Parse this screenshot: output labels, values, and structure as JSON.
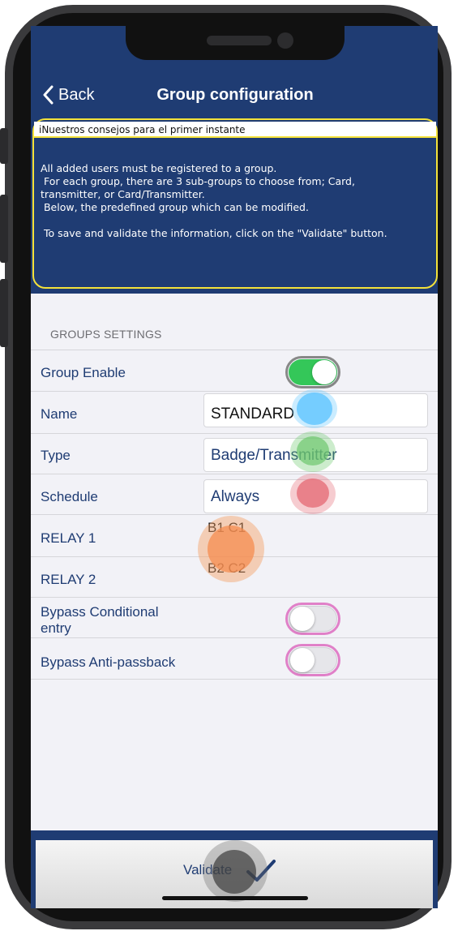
{
  "nav": {
    "back_label": "Back",
    "title": "Group configuration"
  },
  "tips": {
    "title": "iNuestros consejos para el primer instante",
    "body": "All added users must be registered to a group.\n For each group, there are 3 sub-groups to choose from; Card,\ntransmitter, or Card/Transmitter.\n Below, the predefined group which can be modified.\n\n To save and validate the information, click on the \"Validate\" button."
  },
  "settings": {
    "section_label": "GROUPS SETTINGS",
    "group_enable": {
      "label": "Group Enable",
      "on": true
    },
    "name": {
      "label": "Name",
      "value": "STANDARD"
    },
    "type": {
      "label": "Type",
      "value": "Badge/Transmitter"
    },
    "schedule": {
      "label": "Schedule",
      "value": "Always"
    },
    "relay1": {
      "label": "RELAY 1",
      "value": "B1 C1"
    },
    "relay2": {
      "label": "RELAY 2",
      "value": "B2 C2"
    },
    "bypass_conditional": {
      "label": "Bypass Conditional\nentry",
      "on": false
    },
    "bypass_antipassback": {
      "label": "Bypass Anti-passback",
      "on": false
    }
  },
  "footer": {
    "validate_label": "Validate"
  },
  "colors": {
    "header_bg": "#1f3c73",
    "accent_yellow": "#f4e23a",
    "toggle_on": "#34c759",
    "screen_bg": "#f2f2f7"
  },
  "icons": [
    "chevron-left-icon",
    "checkmark-icon"
  ]
}
